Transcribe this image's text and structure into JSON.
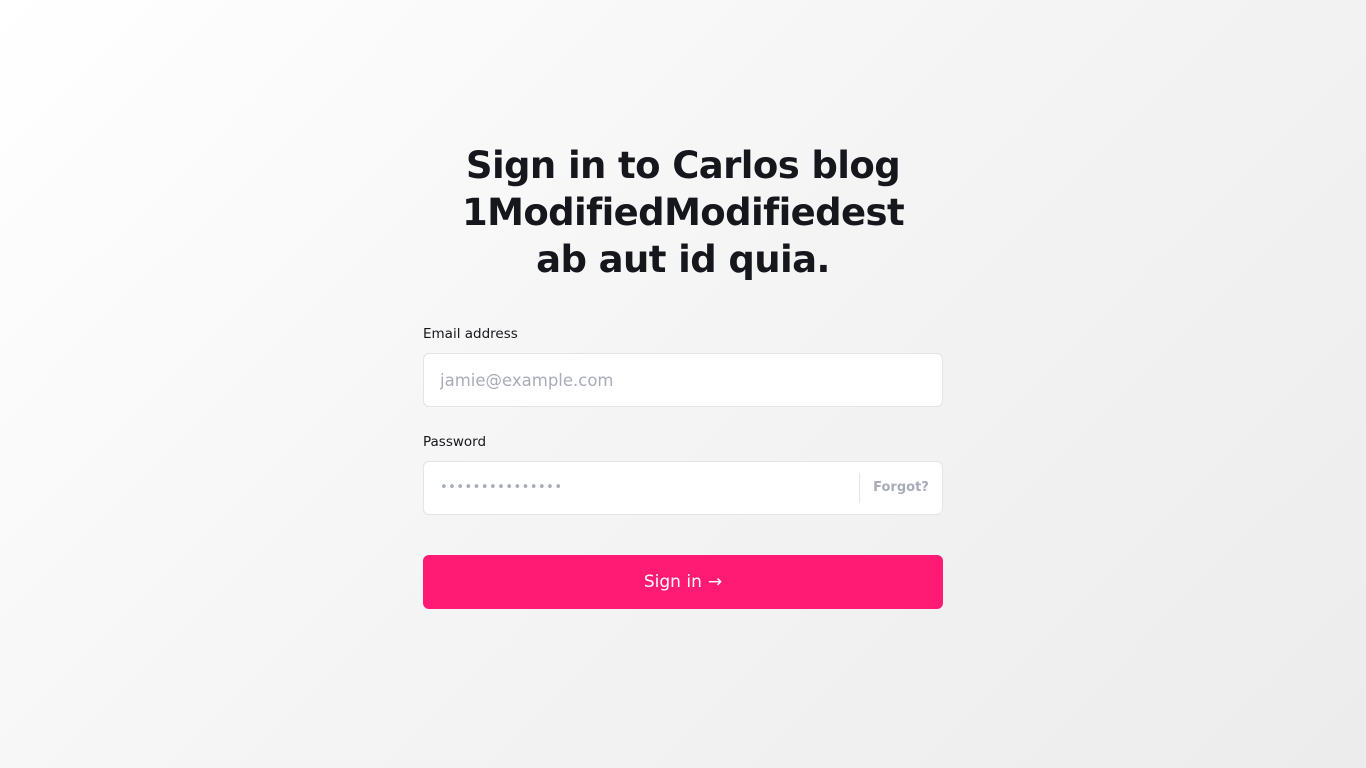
{
  "page": {
    "title": "Sign in to Carlos blog 1ModifiedModifiedest ab aut id quia."
  },
  "form": {
    "email": {
      "label": "Email address",
      "placeholder": "jamie@example.com",
      "value": ""
    },
    "password": {
      "label": "Password",
      "masked_value": "•••••••••••••••",
      "forgot_label": "Forgot?"
    },
    "submit": {
      "label": "Sign in",
      "arrow": "→"
    }
  },
  "colors": {
    "accent": "#ff1a74",
    "text": "#16161d",
    "muted": "#a7acb8",
    "border": "#e3e3e8"
  }
}
